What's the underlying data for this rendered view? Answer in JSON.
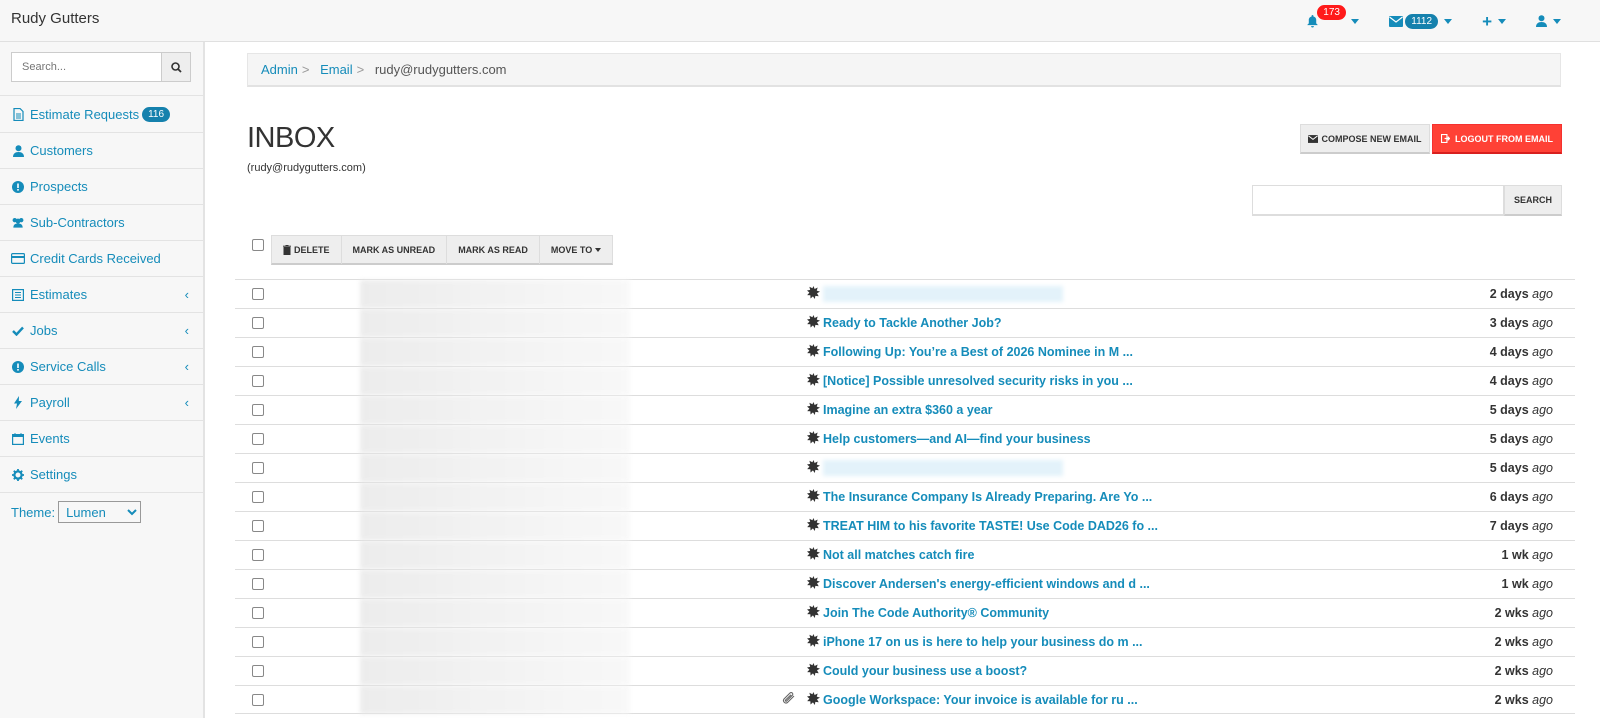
{
  "app": {
    "brand": "Rudy Gutters"
  },
  "navbar": {
    "notifications_count": "173",
    "mail_count": "1112"
  },
  "sidebar": {
    "search_placeholder": "Search...",
    "items": [
      {
        "label": "Estimate Requests",
        "icon": "file-icon",
        "badge": "116"
      },
      {
        "label": "Customers",
        "icon": "user-icon"
      },
      {
        "label": "Prospects",
        "icon": "exclamation-icon"
      },
      {
        "label": "Sub-Contractors",
        "icon": "users-icon"
      },
      {
        "label": "Credit Cards Received",
        "icon": "credit-card-icon"
      },
      {
        "label": "Estimates",
        "icon": "list-icon",
        "expandable": true
      },
      {
        "label": "Jobs",
        "icon": "check-icon",
        "expandable": true
      },
      {
        "label": "Service Calls",
        "icon": "exclamation-icon",
        "expandable": true
      },
      {
        "label": "Payroll",
        "icon": "bolt-icon",
        "expandable": true
      },
      {
        "label": "Events",
        "icon": "calendar-icon"
      },
      {
        "label": "Settings",
        "icon": "gear-icon"
      }
    ],
    "theme_label": "Theme:",
    "theme_value": "Lumen"
  },
  "breadcrumb": {
    "items": [
      "Admin",
      "Email"
    ],
    "current": "rudy@rudygutters.com"
  },
  "inbox": {
    "title": "INBOX",
    "subtitle": "(rudy@rudygutters.com)",
    "compose_label": "COMPOSE NEW EMAIL",
    "logout_label": "LOGOUT FROM EMAIL",
    "search_label": "SEARCH",
    "toolbar": {
      "delete": "DELETE",
      "mark_unread": "MARK AS UNREAD",
      "mark_read": "MARK AS READ",
      "move_to": "MOVE TO"
    }
  },
  "emails": [
    {
      "subject": "",
      "redacted": true,
      "when_num": "2 days",
      "when_suffix": "ago"
    },
    {
      "subject": "Ready to Tackle Another Job?",
      "when_num": "3 days",
      "when_suffix": "ago"
    },
    {
      "subject": "Following Up: You’re a Best of 2026 Nominee in M ...",
      "when_num": "4 days",
      "when_suffix": "ago"
    },
    {
      "subject": "[Notice] Possible unresolved security risks in you ...",
      "when_num": "4 days",
      "when_suffix": "ago"
    },
    {
      "subject": "Imagine an extra $360 a year",
      "when_num": "5 days",
      "when_suffix": "ago"
    },
    {
      "subject": "Help customers—and AI—find your business",
      "when_num": "5 days",
      "when_suffix": "ago"
    },
    {
      "subject": "",
      "redacted": true,
      "when_num": "5 days",
      "when_suffix": "ago"
    },
    {
      "subject": "The Insurance Company Is Already Preparing. Are Yo ...",
      "when_num": "6 days",
      "when_suffix": "ago"
    },
    {
      "subject": "TREAT HIM to his favorite TASTE! Use Code DAD26 fo ...",
      "when_num": "7 days",
      "when_suffix": "ago"
    },
    {
      "subject": "Not all matches catch fire",
      "when_num": "1 wk",
      "when_suffix": "ago"
    },
    {
      "subject": "Discover Andersen's energy-efficient windows and d ...",
      "when_num": "1 wk",
      "when_suffix": "ago"
    },
    {
      "subject": "Join The Code Authority® Community",
      "when_num": "2 wks",
      "when_suffix": "ago"
    },
    {
      "subject": "iPhone 17 on us is here to help your business do m ...",
      "when_num": "2 wks",
      "when_suffix": "ago"
    },
    {
      "subject": "Could your business use a boost?",
      "when_num": "2 wks",
      "when_suffix": "ago"
    },
    {
      "subject": "Google Workspace: Your invoice is available for ru ...",
      "attachment": true,
      "when_num": "2 wks",
      "when_suffix": "ago"
    }
  ]
}
